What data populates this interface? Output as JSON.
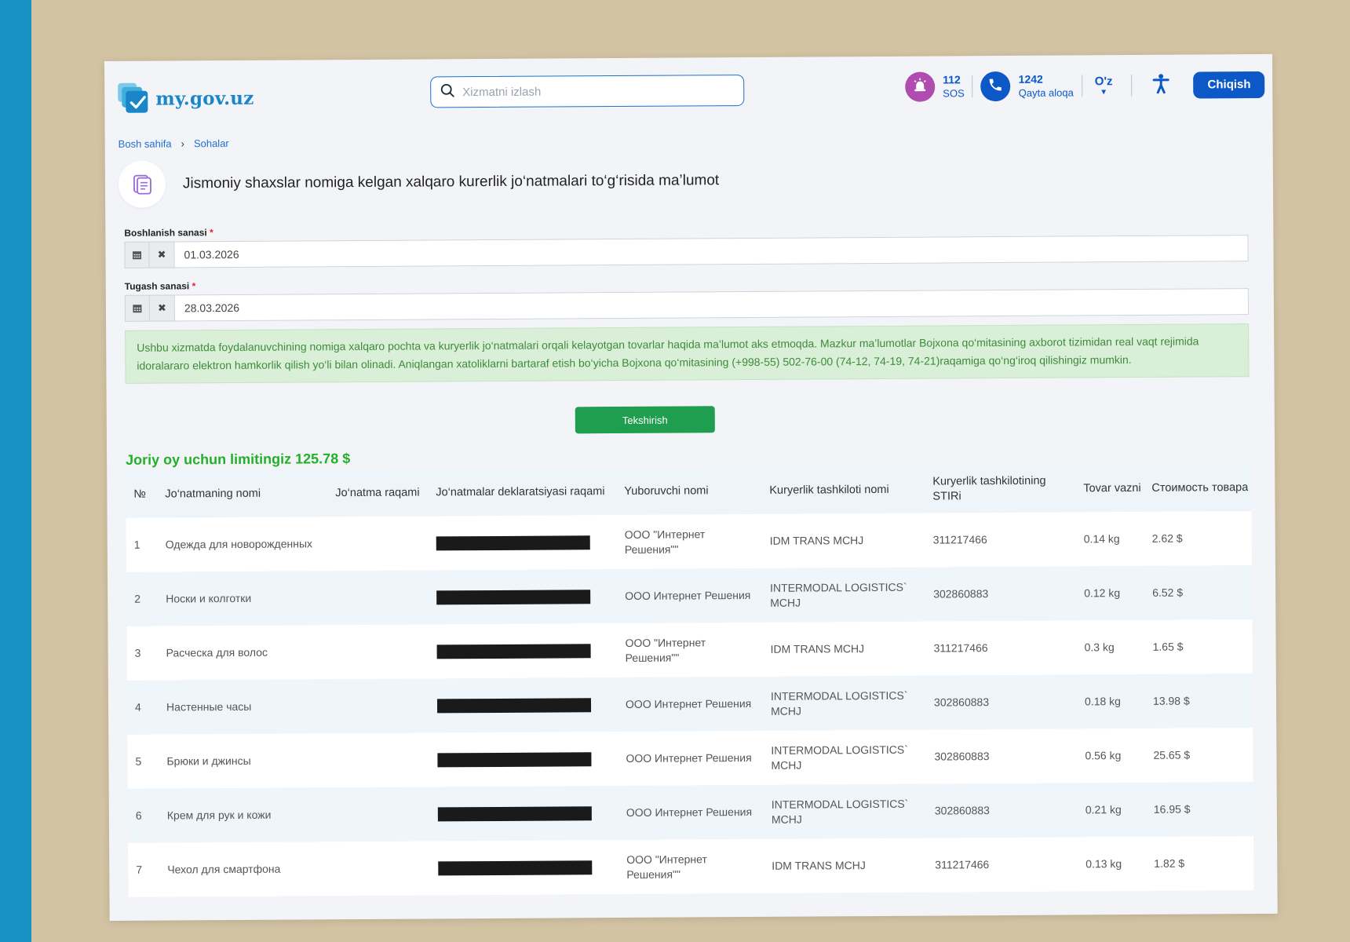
{
  "header": {
    "logo_text": "my.gov.uz",
    "search_placeholder": "Xizmatni izlash",
    "sos_number": "112",
    "sos_label": "SOS",
    "call_number": "1242",
    "call_label": "Qayta aloqa",
    "language": "O'z",
    "logout_label": "Chiqish"
  },
  "breadcrumb": [
    "Bosh sahifa",
    "Sohalar"
  ],
  "page_title": "Jismoniy shaxslar nomiga kelgan xalqaro kurerlik jo‘natmalari to‘g‘risida ma’lumot",
  "form": {
    "start_label": "Boshlanish sanasi",
    "start_value": "01.03.2026",
    "end_label": "Tugash sanasi",
    "end_value": "28.03.2026",
    "required_mark": "*"
  },
  "info_text": "Ushbu xizmatda foydalanuvchining nomiga xalqaro pochta va kuryerlik jo‘natmalari orqali kelayotgan tovarlar haqida ma’lumot aks etmoqda. Mazkur ma’lumotlar Bojxona qo‘mitasining axborot tizimidan real vaqt rejimida idoralararo elektron hamkorlik qilish yo‘li bilan olinadi. Aniqlangan xatoliklarni bartaraf etish bo‘yicha Bojxona qo‘mitasining (+998-55) 502-76-00 (74-12, 74-19, 74-21)raqamiga qo‘ng‘iroq qilishingiz mumkin.",
  "check_button": "Tekshirish",
  "limit_text": "Joriy oy uchun limitingiz 125.78 $",
  "table": {
    "headers": {
      "num": "№",
      "name": "Jo‘natmaning nomi",
      "shipment": "Jo‘natma raqami",
      "declaration": "Jo‘natmalar deklaratsiyasi raqami",
      "sender": "Yuboruvchi nomi",
      "courier": "Kuryerlik tashkiloti nomi",
      "stir": "Kuryerlik tashkilotining STIRi",
      "weight": "Tovar vazni",
      "cost": "Стоимость товара"
    },
    "rows": [
      {
        "num": "1",
        "name": "Одежда для новорожденных",
        "shipment": "",
        "sender": "ООО \"Интернет Решения\"\"",
        "courier": "IDM TRANS MCHJ",
        "stir": "311217466",
        "weight": "0.14 kg",
        "cost": "2.62 $"
      },
      {
        "num": "2",
        "name": "Носки и колготки",
        "shipment": "",
        "sender": "ООО Интернет Решения",
        "courier": "INTERMODAL LOGISTICS` MCHJ",
        "stir": "302860883",
        "weight": "0.12 kg",
        "cost": "6.52 $"
      },
      {
        "num": "3",
        "name": "Расческа для волос",
        "shipment": "",
        "sender": "ООО \"Интернет Решения\"\"",
        "courier": "IDM TRANS MCHJ",
        "stir": "311217466",
        "weight": "0.3 kg",
        "cost": "1.65 $"
      },
      {
        "num": "4",
        "name": "Настенные часы",
        "shipment": "",
        "sender": "ООО Интернет Решения",
        "courier": "INTERMODAL LOGISTICS` MCHJ",
        "stir": "302860883",
        "weight": "0.18 kg",
        "cost": "13.98 $"
      },
      {
        "num": "5",
        "name": "Брюки и джинсы",
        "shipment": "",
        "sender": "ООО Интернет Решения",
        "courier": "INTERMODAL LOGISTICS` MCHJ",
        "stir": "302860883",
        "weight": "0.56 kg",
        "cost": "25.65 $"
      },
      {
        "num": "6",
        "name": "Крем для рук и кожи",
        "shipment": "",
        "sender": "ООО Интернет Решения",
        "courier": "INTERMODAL LOGISTICS` MCHJ",
        "stir": "302860883",
        "weight": "0.21 kg",
        "cost": "16.95 $"
      },
      {
        "num": "7",
        "name": "Чехол для смартфона",
        "shipment": "",
        "sender": "ООО \"Интернет Решения\"\"",
        "courier": "IDM TRANS MCHJ",
        "stir": "311217466",
        "weight": "0.13 kg",
        "cost": "1.82 $"
      }
    ]
  },
  "colors": {
    "primary": "#0c58c7",
    "sos": "#b04bb0",
    "success": "#1f9e4f",
    "limit": "#22b02a",
    "info_bg": "#d9efd7"
  },
  "icons": [
    "search-icon",
    "alarm-icon",
    "phone-icon",
    "caret-down-icon",
    "accessibility-icon",
    "document-icon",
    "calendar-icon",
    "clear-icon"
  ]
}
